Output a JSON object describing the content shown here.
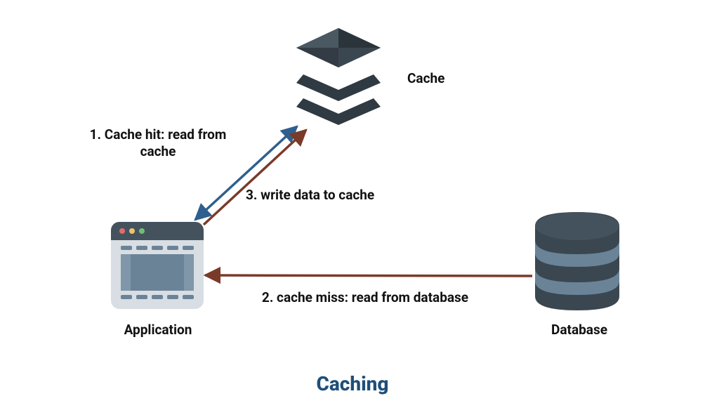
{
  "title": "Caching",
  "nodes": {
    "cache": {
      "label": "Cache"
    },
    "application": {
      "label": "Application"
    },
    "database": {
      "label": "Database"
    }
  },
  "edges": {
    "cache_hit": {
      "label_line1": "1. Cache hit: read from",
      "label_line2": "cache"
    },
    "write_cache": {
      "label": "3. write data to cache"
    },
    "cache_miss": {
      "label": "2. cache miss: read from database"
    }
  },
  "colors": {
    "arrow_blue": "#2f5f8f",
    "arrow_brown": "#7a3a2a",
    "text_dark": "#111111",
    "title_blue": "#1f4e79",
    "icon_dark": "#333a40",
    "icon_midgrey": "#44525e",
    "icon_slate": "#6a8397",
    "icon_lightgrey": "#d8dee3"
  }
}
